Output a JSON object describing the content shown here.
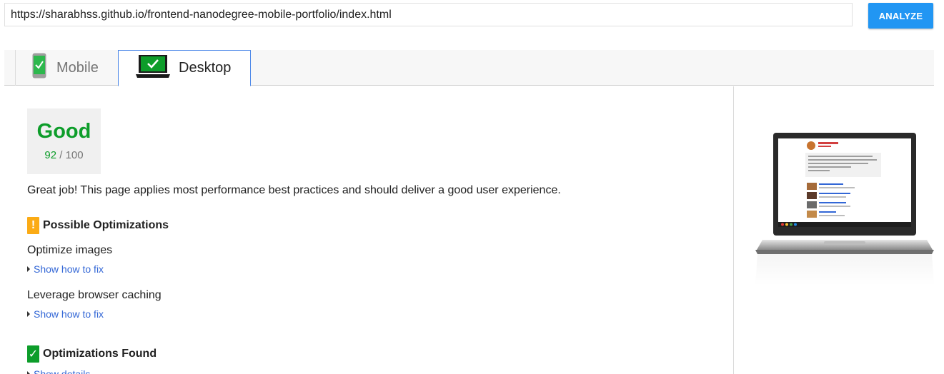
{
  "url_input": {
    "value": "https://sharabhss.github.io/frontend-nanodegree-mobile-portfolio/index.html"
  },
  "analyze_button": {
    "label": "ANALYZE"
  },
  "tabs": [
    {
      "label": "Mobile",
      "icon": "mobile-phone-check-icon",
      "selected": false
    },
    {
      "label": "Desktop",
      "icon": "laptop-check-icon",
      "selected": true
    }
  ],
  "score": {
    "label": "Good",
    "value": "92",
    "max": "/ 100",
    "color": "#0d9d2a"
  },
  "summary": "Great job! This page applies most performance best practices and should deliver a good user experience.",
  "possible_optimizations": {
    "badge": "!",
    "title": "Possible Optimizations",
    "items": [
      {
        "title": "Optimize images",
        "link": "Show how to fix"
      },
      {
        "title": "Leverage browser caching",
        "link": "Show how to fix"
      }
    ]
  },
  "optimizations_found": {
    "badge": "✓",
    "title": "Optimizations Found",
    "link": "Show details"
  },
  "colors": {
    "accent": "#2196f3",
    "good": "#0d9d2a",
    "warn": "#fbab15",
    "link": "#3367d6"
  }
}
